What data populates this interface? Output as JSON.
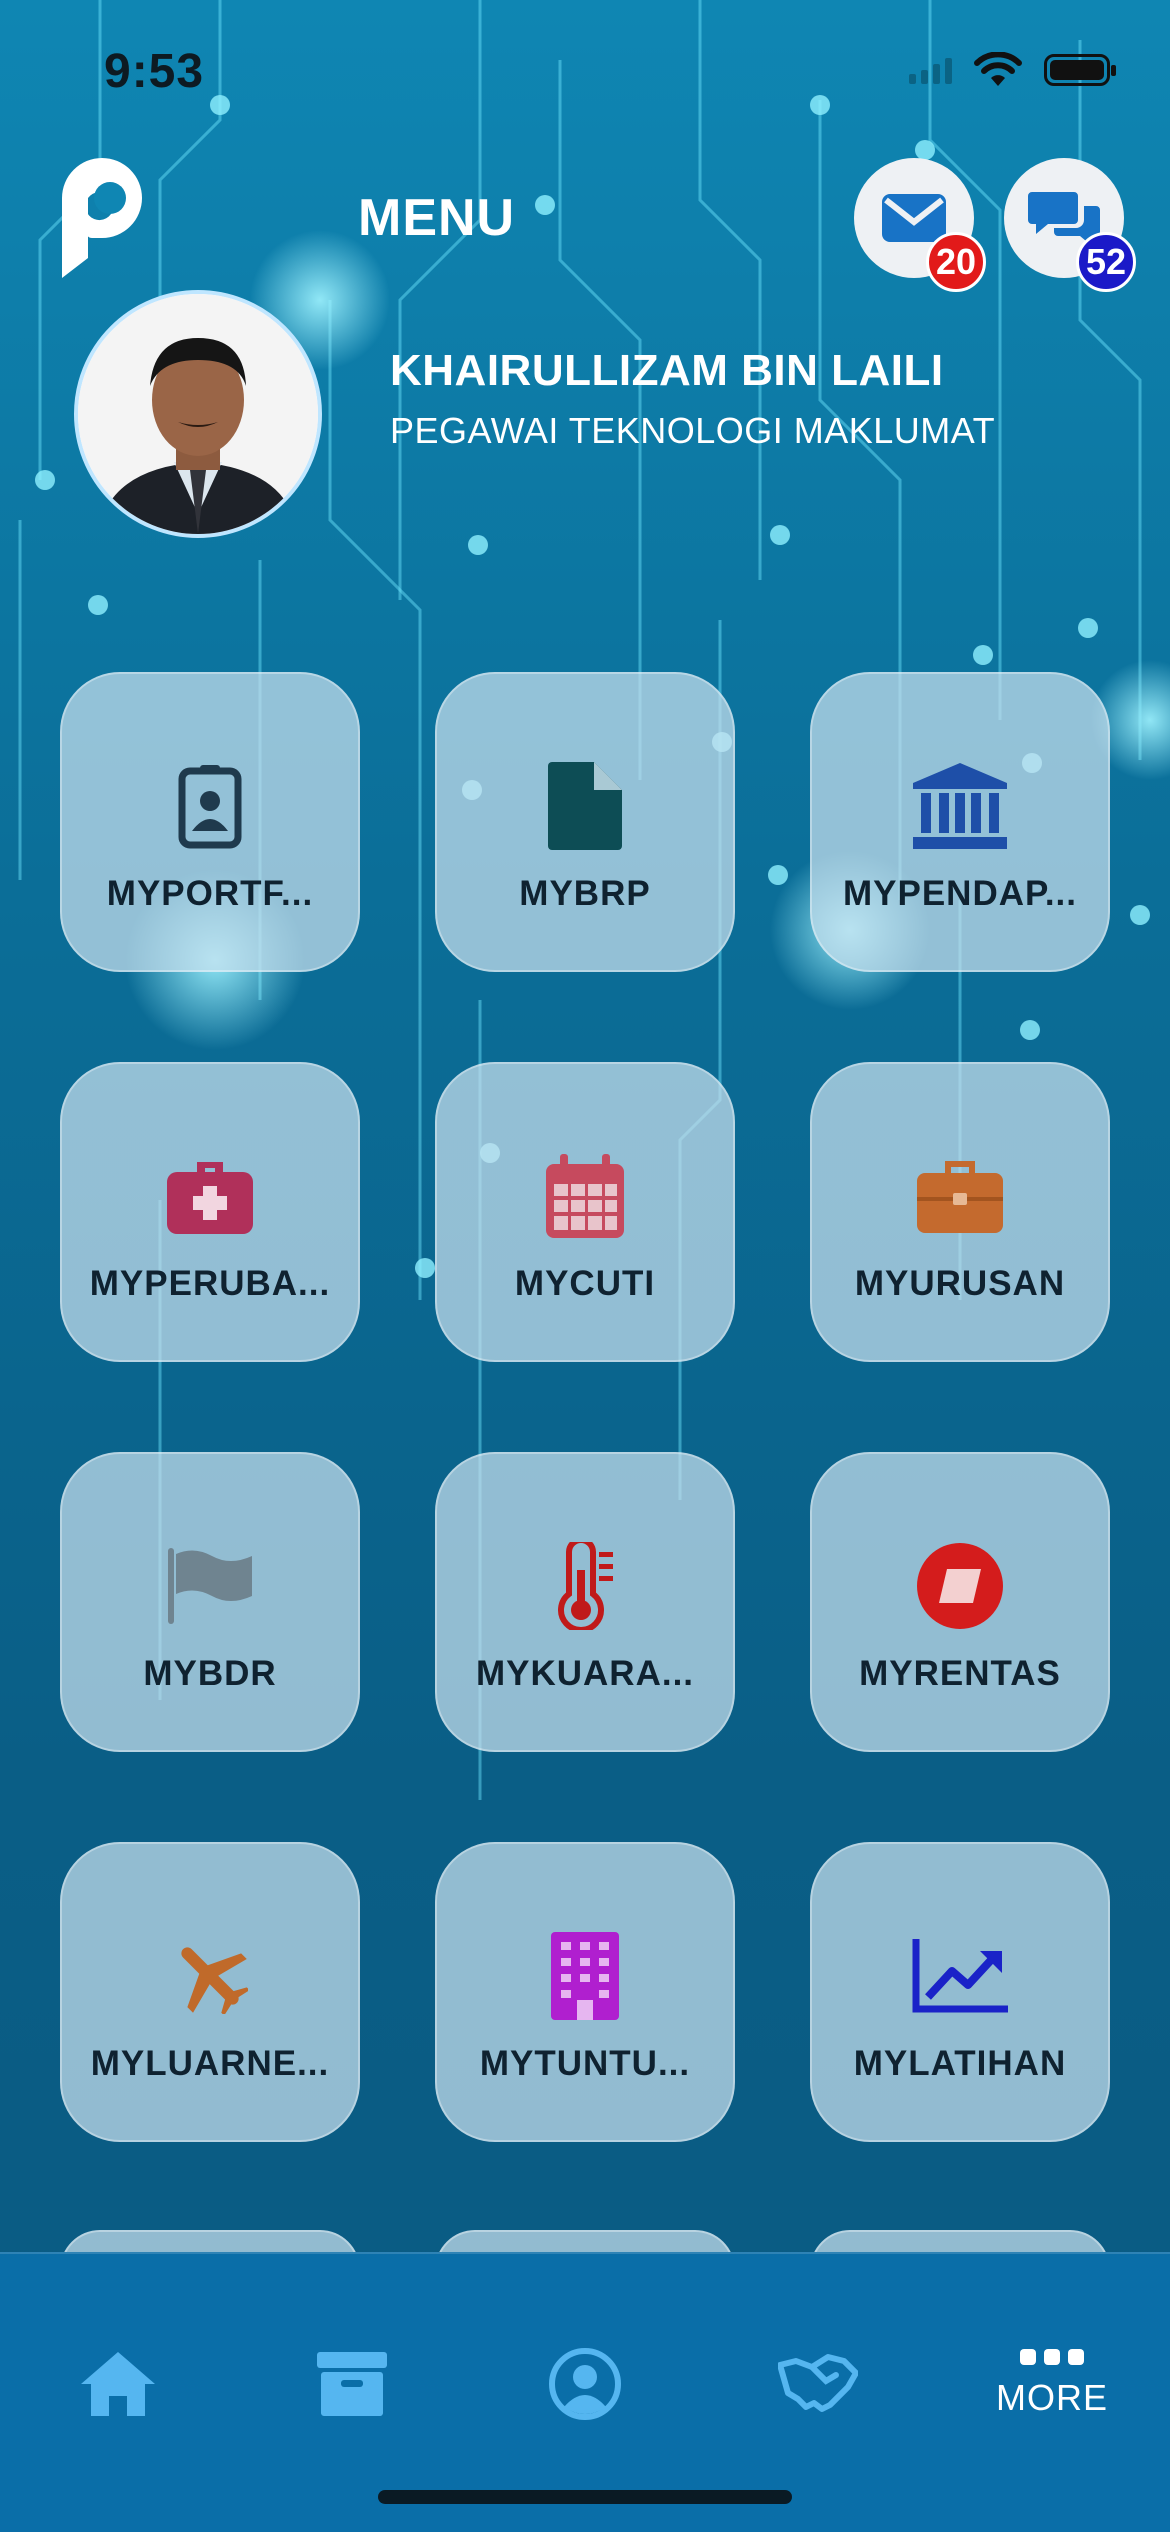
{
  "status_bar": {
    "time": "9:53"
  },
  "header": {
    "title": "MENU",
    "mail_badge": "20",
    "chat_badge": "52"
  },
  "profile": {
    "name": "KHAIRULLIZAM BIN LAILI",
    "role": "PEGAWAI TEKNOLOGI MAKLUMAT"
  },
  "menu": {
    "items": [
      {
        "label": "MYPORTF...",
        "icon": "id-badge-icon",
        "color": "#1f3a4d"
      },
      {
        "label": "MYBRP",
        "icon": "file-icon",
        "color": "#0d4d55"
      },
      {
        "label": "MYPENDAP...",
        "icon": "bank-icon",
        "color": "#1e4fa8"
      },
      {
        "label": "MYPERUBA...",
        "icon": "medical-kit-icon",
        "color": "#b0305a"
      },
      {
        "label": "MYCUTI",
        "icon": "calendar-icon",
        "color": "#c64a5e"
      },
      {
        "label": "MYURUSAN",
        "icon": "briefcase-icon",
        "color": "#c46a2e"
      },
      {
        "label": "MYBDR",
        "icon": "flag-icon",
        "color": "#6f8490"
      },
      {
        "label": "MYKUARA...",
        "icon": "thermometer-icon",
        "color": "#c01a1a"
      },
      {
        "label": "MYRENTAS",
        "icon": "ticket-icon",
        "color": "#d41c1c"
      },
      {
        "label": "MYLUARNE...",
        "icon": "plane-icon",
        "color": "#c06a2a"
      },
      {
        "label": "MYTUNTU...",
        "icon": "building-icon",
        "color": "#b01fcf"
      },
      {
        "label": "MYLATIHAN",
        "icon": "chart-line-icon",
        "color": "#1a22c8"
      }
    ]
  },
  "tab_bar": {
    "items": [
      {
        "name": "home",
        "icon": "home-icon"
      },
      {
        "name": "archive",
        "icon": "archive-icon"
      },
      {
        "name": "profile",
        "icon": "user-circle-icon"
      },
      {
        "name": "handshake",
        "icon": "handshake-icon"
      },
      {
        "name": "more",
        "icon": "more-dots-icon",
        "label": "MORE"
      }
    ]
  },
  "colors": {
    "background": "#0b6e98",
    "tab_bar": "#0a6ea8",
    "tile": "#c8e1ee",
    "badge_red": "#e21a1a",
    "badge_blue": "#1b1ac8"
  }
}
